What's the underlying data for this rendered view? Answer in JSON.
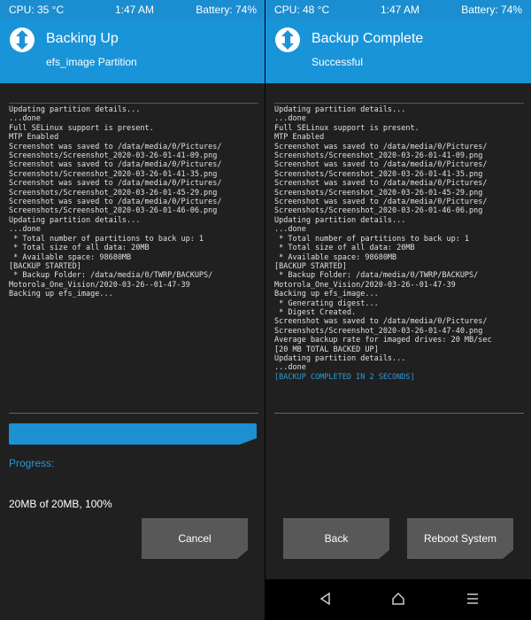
{
  "left": {
    "status": {
      "cpu": "CPU: 35 °C",
      "time": "1:47 AM",
      "battery": "Battery: 74%"
    },
    "header": {
      "title": "Backing Up",
      "subtitle": "efs_image Partition"
    },
    "console": [
      "Updating partition details...",
      "...done",
      "Full SELinux support is present.",
      "MTP Enabled",
      "Screenshot was saved to /data/media/0/Pictures/",
      "Screenshots/Screenshot_2020-03-26-01-41-09.png",
      "Screenshot was saved to /data/media/0/Pictures/",
      "Screenshots/Screenshot_2020-03-26-01-41-35.png",
      "Screenshot was saved to /data/media/0/Pictures/",
      "Screenshots/Screenshot_2020-03-26-01-45-29.png",
      "Screenshot was saved to /data/media/0/Pictures/",
      "Screenshots/Screenshot_2020-03-26-01-46-06.png",
      "Updating partition details...",
      "...done",
      " * Total number of partitions to back up: 1",
      " * Total size of all data: 20MB",
      " * Available space: 98680MB",
      "[BACKUP STARTED]",
      " * Backup Folder: /data/media/0/TWRP/BACKUPS/",
      "Motorola_One_Vision/2020-03-26--01-47-39",
      "Backing up efs_image..."
    ],
    "progress_label": "Progress:",
    "progress_text": "20MB of 20MB, 100%",
    "progress_fraction": 1.0,
    "cancel_label": "Cancel"
  },
  "right": {
    "status": {
      "cpu": "CPU: 48 °C",
      "time": "1:47 AM",
      "battery": "Battery: 74%"
    },
    "header": {
      "title": "Backup Complete",
      "subtitle": "Successful"
    },
    "console": [
      "Updating partition details...",
      "...done",
      "Full SELinux support is present.",
      "MTP Enabled",
      "Screenshot was saved to /data/media/0/Pictures/",
      "Screenshots/Screenshot_2020-03-26-01-41-09.png",
      "Screenshot was saved to /data/media/0/Pictures/",
      "Screenshots/Screenshot_2020-03-26-01-41-35.png",
      "Screenshot was saved to /data/media/0/Pictures/",
      "Screenshots/Screenshot_2020-03-26-01-45-29.png",
      "Screenshot was saved to /data/media/0/Pictures/",
      "Screenshots/Screenshot_2020-03-26-01-46-06.png",
      "Updating partition details...",
      "...done",
      " * Total number of partitions to back up: 1",
      " * Total size of all data: 20MB",
      " * Available space: 98680MB",
      "[BACKUP STARTED]",
      " * Backup Folder: /data/media/0/TWRP/BACKUPS/",
      "Motorola_One_Vision/2020-03-26--01-47-39",
      "Backing up efs_image...",
      " * Generating digest...",
      " * Digest Created.",
      "Screenshot was saved to /data/media/0/Pictures/",
      "Screenshots/Screenshot_2020-03-26-01-47-40.png",
      "Average backup rate for imaged drives: 20 MB/sec",
      "[20 MB TOTAL BACKED UP]",
      "Updating partition details...",
      "...done"
    ],
    "console_done": "[BACKUP COMPLETED IN 2 SECONDS]",
    "back_label": "Back",
    "reboot_label": "Reboot System",
    "nav": {
      "back_icon": "nav-back-icon",
      "home_icon": "nav-home-icon",
      "menu_icon": "nav-menu-icon"
    }
  },
  "colors": {
    "header": "#1994d8",
    "status": "#1a8ed1",
    "accent": "#2996d4",
    "button": "#585858",
    "background": "#202020"
  }
}
